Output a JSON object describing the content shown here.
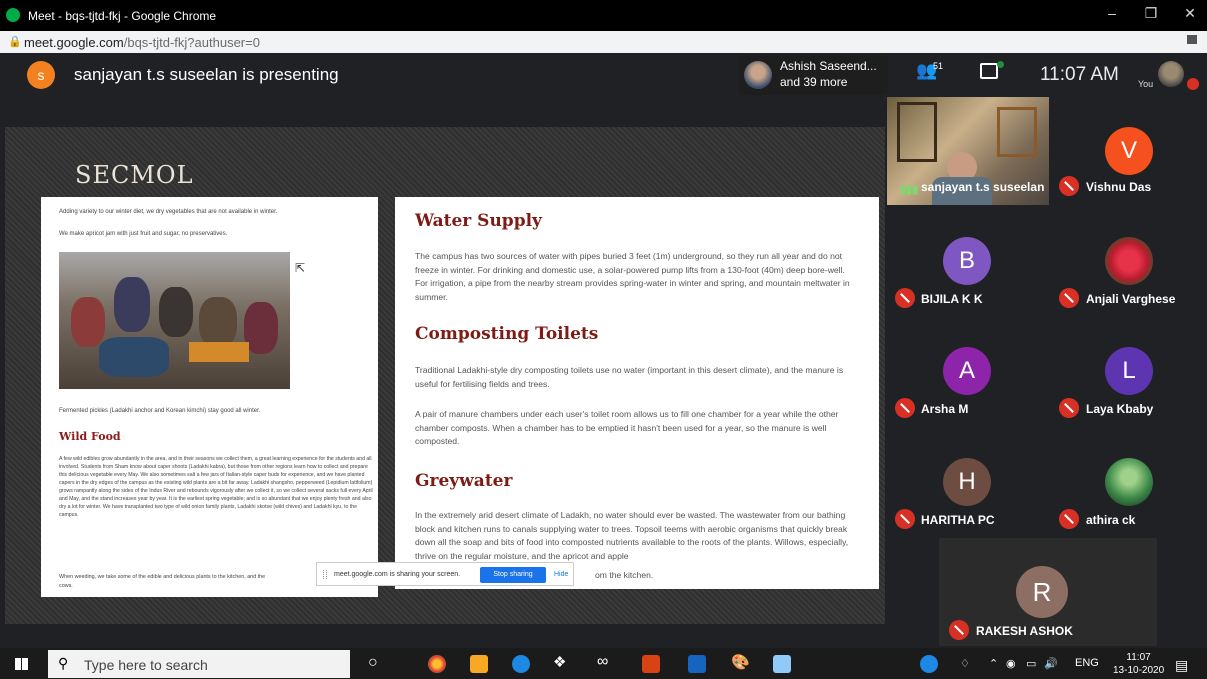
{
  "window": {
    "title": "Meet - bqs-tjtd-fkj - Google Chrome",
    "url_host": "meet.google.com",
    "url_path": "/bqs-tjtd-fkj?authuser=0"
  },
  "meet": {
    "presenter_initial": "s",
    "presenting_text": "sanjayan t.s suseelan is presenting",
    "joined_name": "Ashish Saseend...",
    "joined_more": "and 39 more",
    "people_count": "51",
    "time": "11:07 AM",
    "you_label": "You"
  },
  "slide": {
    "brand": "SECMOL",
    "left": {
      "line1": "Adding variety to our winter diet, we dry vegetables that are not available in winter.",
      "line2": "We make apricot jam with just fruit and sugar, no preservatives.",
      "caption": "Fermented pickles (Ladakhi anchor and Korean kimchi) stay good all winter.",
      "wild_food_heading": "Wild Food",
      "wild_food_body": "A few wild edibles grow abundantly in the area, and in their seasons we collect them, a great learning experience for the students and all involved. Students from Sham know about caper shoots (Ladakhi kabra), but those from other regions learn how to collect and prepare this delicious vegetable every May. We also sometimes salt a few jars of Italian-style caper buds for experience, and we have planted capers in the dry edges of the campus as the existing wild plants are a bit far away. Ladakhi shangsho, pepperweed (Lepidium latifolium) grows rampantly along the sides of the Indus River and rebounds vigorously after we collect it, so we collect several sacks full every April and May, and the stand increases year by year. It is the earliest spring vegetable; and is so abundant that we enjoy plenty fresh and also dry a lot for winter. We have transplanted two type of wild onion family plants, Ladakhi skotse (wild chives) and Ladakhi kyu, to the campus.",
      "weeding_line": "When weeding, we take some of the edible and delicious plants to the kitchen, and the",
      "weeding_end": "cows."
    },
    "right": {
      "h_water": "Water Supply",
      "p_water": "The campus has two sources of water with pipes buried 3 feet (1m) underground, so they run all year and do not freeze in winter. For drinking and domestic use, a solar-powered pump lifts from a 130-foot (40m) deep bore-well. For irrigation, a pipe from the nearby stream provides spring-water in winter and spring, and mountain meltwater in summer.",
      "h_toilets": "Composting Toilets",
      "p_toilets1": "Traditional Ladakhi-style dry composting toilets use no water (important in this desert climate), and the manure is useful for fertilising fields and trees.",
      "p_toilets2": "A pair of manure chambers under each user's toilet room allows us to fill one chamber for a year while the other chamber composts. When a chamber has to be emptied it hasn't been used for a year, so the manure is well composted.",
      "h_grey": "Greywater",
      "p_grey": "In the extremely arid desert climate of Ladakh, no water should ever be wasted. The wastewater from our bathing block and kitchen runs to canals supplying water to trees. Topsoil teems with aerobic organisms that quickly break down all the soap and bits of food into composted nutrients available to the roots of the plants. Willows, especially, thrive on the regular moisture, and the apricot and apple",
      "p_grey_end": "om the kitchen."
    }
  },
  "share_bar": {
    "message": "meet.google.com is sharing your screen.",
    "stop": "Stop sharing",
    "hide": "Hide"
  },
  "participants": [
    {
      "name": "sanjayan t.s suseelan"
    },
    {
      "name": "Vishnu Das",
      "initial": "V",
      "color": "#f4511e"
    },
    {
      "name": "BIJILA K K",
      "initial": "B",
      "color": "#7e57c2"
    },
    {
      "name": "Anjali Varghese",
      "photo": "rose"
    },
    {
      "name": "Arsha M",
      "initial": "A",
      "color": "#8e24aa"
    },
    {
      "name": "Laya Kbaby",
      "initial": "L",
      "color": "#5e35b1"
    },
    {
      "name": "HARITHA PC",
      "initial": "H",
      "color": "#6d4c41"
    },
    {
      "name": "athira ck",
      "photo": "nature"
    },
    {
      "name": "RAKESH ASHOK",
      "initial": "R",
      "color": "#8d6e63"
    }
  ],
  "taskbar": {
    "search_placeholder": "Type here to search",
    "lang": "ENG",
    "time": "11:07",
    "date": "13-10-2020"
  }
}
